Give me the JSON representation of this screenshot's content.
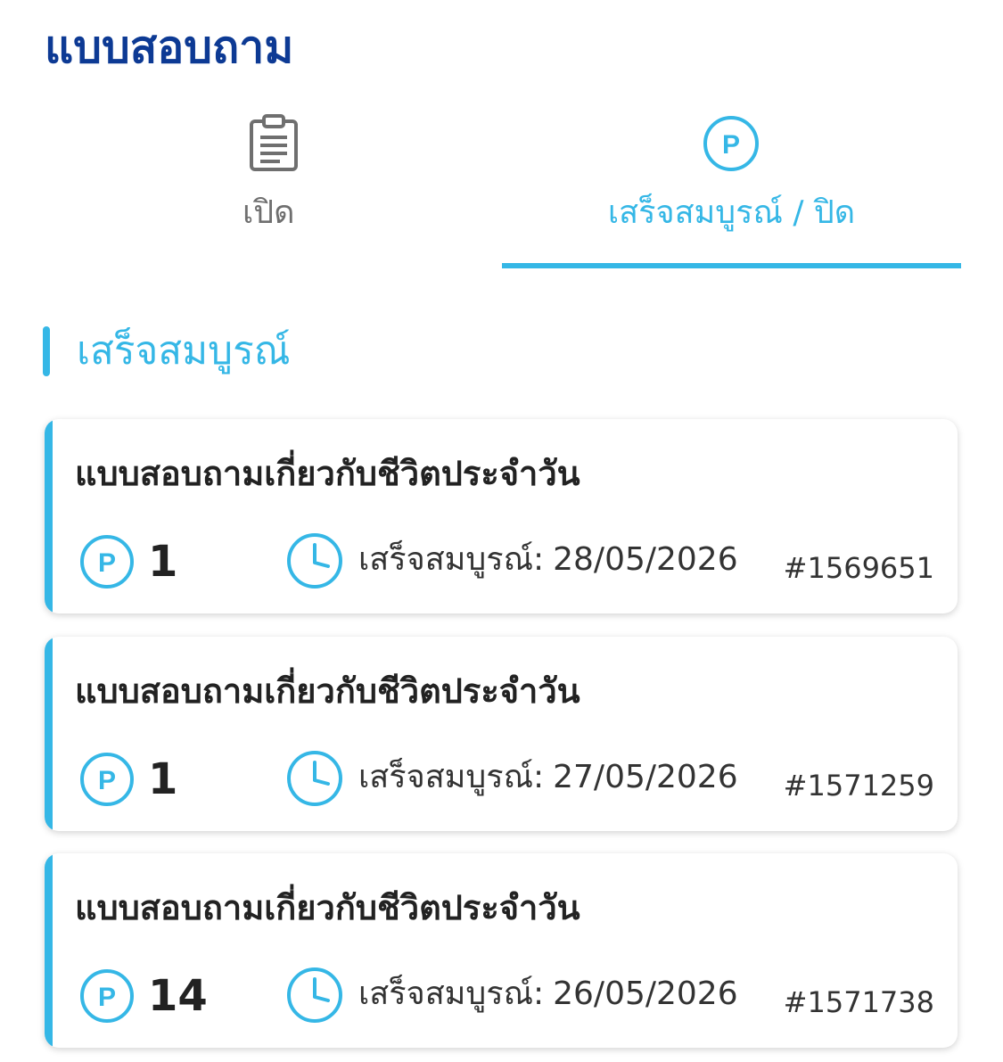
{
  "page": {
    "title": "แบบสอบถาม"
  },
  "tabs": [
    {
      "label": "เปิด",
      "icon": "clipboard-icon",
      "active": false
    },
    {
      "label": "เสร็จสมบูรณ์ / ปิด",
      "icon": "points-p-icon",
      "active": true
    }
  ],
  "section": {
    "title": "เสร็จสมบูรณ์"
  },
  "cards": [
    {
      "title": "แบบสอบถามเกี่ยวกับชีวิตประจำวัน",
      "points": "1",
      "completed_label": "เสร็จสมบูรณ์:",
      "completed_date": "28/05/2026",
      "id": "#1569651"
    },
    {
      "title": "แบบสอบถามเกี่ยวกับชีวิตประจำวัน",
      "points": "1",
      "completed_label": "เสร็จสมบูรณ์:",
      "completed_date": "27/05/2026",
      "id": "#1571259"
    },
    {
      "title": "แบบสอบถามเกี่ยวกับชีวิตประจำวัน",
      "points": "14",
      "completed_label": "เสร็จสมบูรณ์:",
      "completed_date": "26/05/2026",
      "id": "#1571738"
    }
  ],
  "colors": {
    "title_blue": "#0d3a94",
    "accent": "#35b7e6",
    "inactive_gray": "#6f6f6f"
  }
}
